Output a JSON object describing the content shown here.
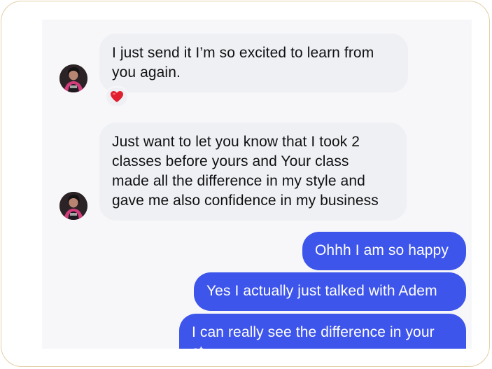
{
  "conversation": {
    "messages": [
      {
        "direction": "incoming",
        "lines": [
          "I just send it I’m so excited to learn from",
          "you again."
        ],
        "reaction": "heart-icon"
      },
      {
        "direction": "incoming",
        "lines": [
          "Just want to let you know that I took 2",
          "classes before yours and Your class",
          "made all the difference in my style and",
          "gave me also confidence in my business"
        ]
      },
      {
        "direction": "outgoing",
        "lines": [
          "Ohhh I am so happy"
        ]
      },
      {
        "direction": "outgoing",
        "lines": [
          "Yes I actually just talked with Adem"
        ]
      },
      {
        "direction": "outgoing",
        "lines": [
          "I can really see the difference in your",
          "st"
        ]
      }
    ]
  },
  "colors": {
    "incoming_bubble": "#eef0f4",
    "outgoing_bubble": "#3d55ea",
    "heart": "#e0202f",
    "frame_border": "#e3cfa6"
  }
}
